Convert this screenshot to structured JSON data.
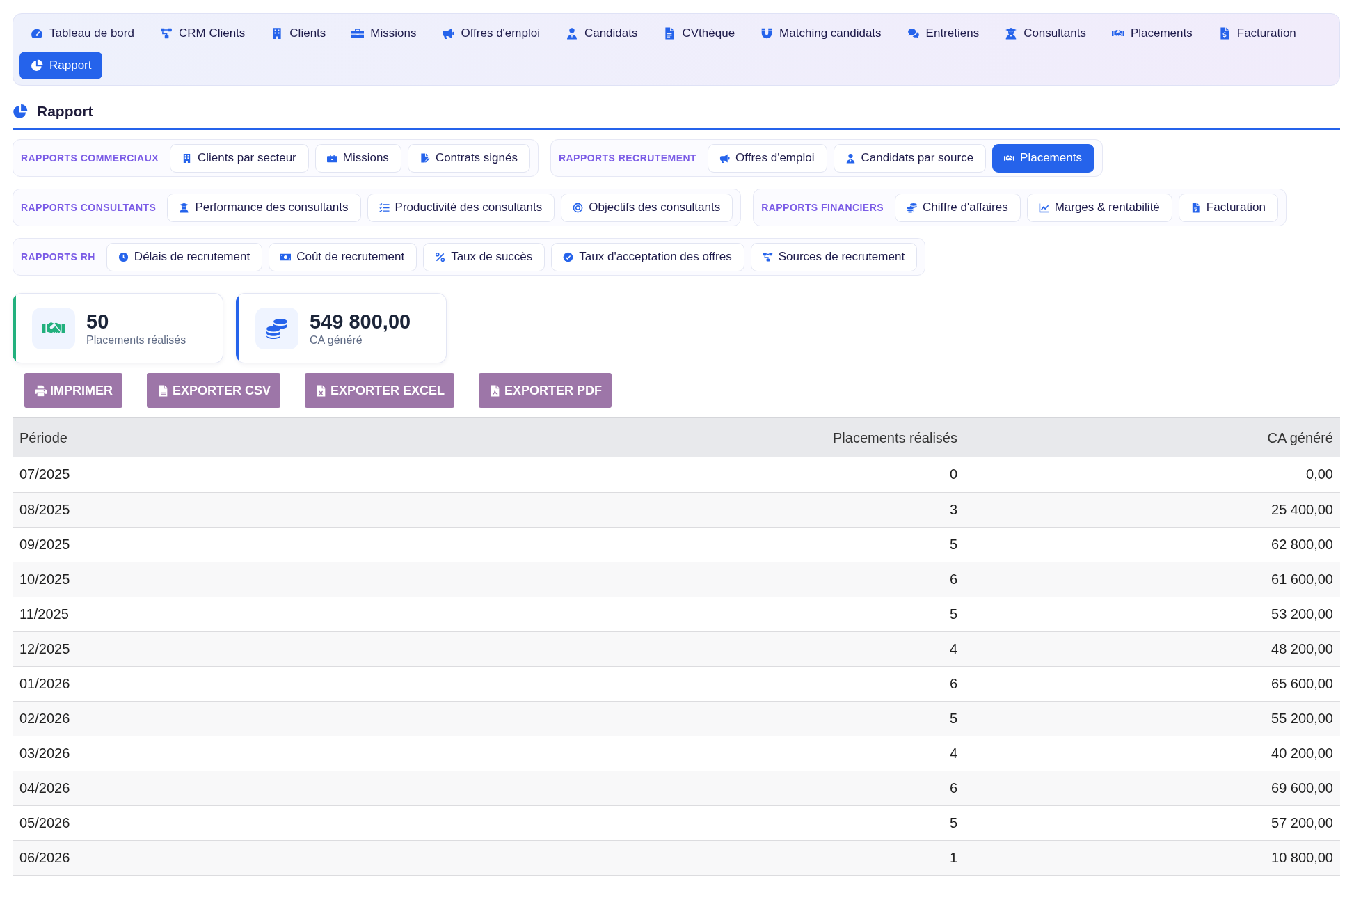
{
  "nav": {
    "items": [
      {
        "label": "Tableau de bord",
        "selected": false
      },
      {
        "label": "CRM Clients",
        "selected": false
      },
      {
        "label": "Clients",
        "selected": false
      },
      {
        "label": "Missions",
        "selected": false
      },
      {
        "label": "Offres d'emploi",
        "selected": false
      },
      {
        "label": "Candidats",
        "selected": false
      },
      {
        "label": "CVthèque",
        "selected": false
      },
      {
        "label": "Matching candidats",
        "selected": false
      },
      {
        "label": "Entretiens",
        "selected": false
      },
      {
        "label": "Consultants",
        "selected": false
      },
      {
        "label": "Placements",
        "selected": false
      },
      {
        "label": "Facturation",
        "selected": false
      },
      {
        "label": "Rapport",
        "selected": true
      }
    ]
  },
  "page_title": "Rapport",
  "report_groups": [
    {
      "label": "RAPPORTS COMMERCIAUX",
      "reports": [
        {
          "label": "Clients par secteur",
          "selected": false
        },
        {
          "label": "Missions",
          "selected": false
        },
        {
          "label": "Contrats signés",
          "selected": false
        }
      ]
    },
    {
      "label": "RAPPORTS RECRUTEMENT",
      "reports": [
        {
          "label": "Offres d'emploi",
          "selected": false
        },
        {
          "label": "Candidats par source",
          "selected": false
        },
        {
          "label": "Placements",
          "selected": true
        }
      ]
    },
    {
      "label": "RAPPORTS CONSULTANTS",
      "reports": [
        {
          "label": "Performance des consultants",
          "selected": false
        },
        {
          "label": "Productivité des consultants",
          "selected": false
        },
        {
          "label": "Objectifs des consultants",
          "selected": false
        }
      ]
    },
    {
      "label": "RAPPORTS FINANCIERS",
      "reports": [
        {
          "label": "Chiffre d'affaires",
          "selected": false
        },
        {
          "label": "Marges & rentabilité",
          "selected": false
        },
        {
          "label": "Facturation",
          "selected": false
        }
      ]
    },
    {
      "label": "RAPPORTS RH",
      "reports": [
        {
          "label": "Délais de recrutement",
          "selected": false
        },
        {
          "label": "Coût de recrutement",
          "selected": false
        },
        {
          "label": "Taux de succès",
          "selected": false
        },
        {
          "label": "Taux d'acceptation des offres",
          "selected": false
        },
        {
          "label": "Sources de recrutement",
          "selected": false
        }
      ]
    }
  ],
  "stats": [
    {
      "value": "50",
      "label": "Placements réalisés",
      "color": "#22b07d"
    },
    {
      "value": "549 800,00",
      "label": "CA généré",
      "color": "#2563eb"
    }
  ],
  "actions": [
    "IMPRIMER",
    "EXPORTER CSV",
    "EXPORTER EXCEL",
    "EXPORTER PDF"
  ],
  "table": {
    "columns": [
      "Période",
      "Placements réalisés",
      "CA généré"
    ],
    "rows": [
      [
        "07/2025",
        "0",
        "0,00"
      ],
      [
        "08/2025",
        "3",
        "25 400,00"
      ],
      [
        "09/2025",
        "5",
        "62 800,00"
      ],
      [
        "10/2025",
        "6",
        "61 600,00"
      ],
      [
        "11/2025",
        "5",
        "53 200,00"
      ],
      [
        "12/2025",
        "4",
        "48 200,00"
      ],
      [
        "01/2026",
        "6",
        "65 600,00"
      ],
      [
        "02/2026",
        "5",
        "55 200,00"
      ],
      [
        "03/2026",
        "4",
        "40 200,00"
      ],
      [
        "04/2026",
        "6",
        "69 600,00"
      ],
      [
        "05/2026",
        "5",
        "57 200,00"
      ],
      [
        "06/2026",
        "1",
        "10 800,00"
      ]
    ]
  }
}
